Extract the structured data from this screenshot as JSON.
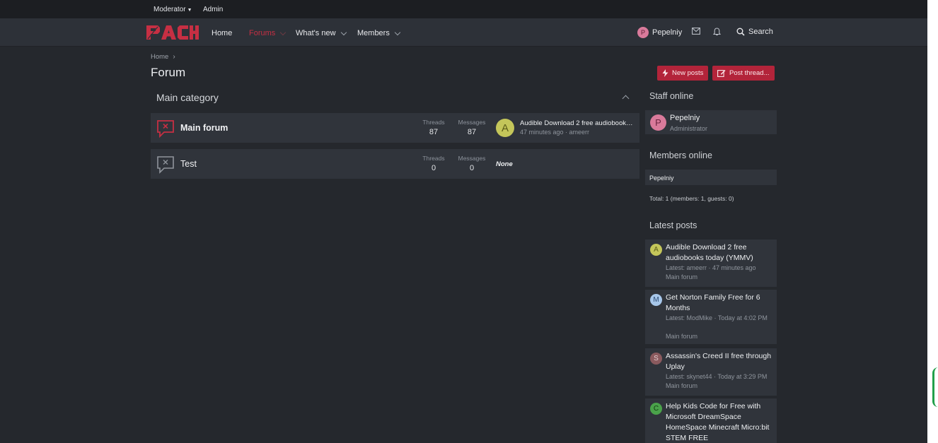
{
  "topbar": {
    "moderator": "Moderator",
    "admin": "Admin"
  },
  "brand": {
    "logo_text": "PACH",
    "accent": "#c62f43"
  },
  "nav": {
    "home": "Home",
    "forums": "Forums",
    "whats_new": "What's new",
    "members": "Members",
    "user": "Pepelniy",
    "user_initial": "P",
    "search": "Search"
  },
  "breadcrumb": {
    "home": "Home"
  },
  "page": {
    "title": "Forum",
    "new_posts": "New posts",
    "post_thread": "Post thread..."
  },
  "category": {
    "title": "Main category",
    "forums": [
      {
        "title": "Main forum",
        "threads_label": "Threads",
        "threads": "87",
        "messages_label": "Messages",
        "messages": "87",
        "latest_initial": "A",
        "latest_title": "Audible Download 2 free audiobooks today (YMMV)",
        "latest_meta": "47 minutes ago · ameerr"
      },
      {
        "title": "Test",
        "threads_label": "Threads",
        "threads": "0",
        "messages_label": "Messages",
        "messages": "0",
        "latest_none": "None"
      }
    ]
  },
  "sidebar": {
    "staff_title": "Staff online",
    "staff": {
      "initial": "P",
      "name": "Pepelniy",
      "role": "Administrator"
    },
    "members_title": "Members online",
    "members": [
      "Pepelniy"
    ],
    "total": "Total: 1 (members: 1, guests: 0)",
    "latest_title": "Latest posts",
    "latest_posts": [
      {
        "initial": "A",
        "color": "#c4c65a",
        "title": "Audible Download 2 free audiobooks today (YMMV)",
        "meta": "Latest: ameerr · 47 minutes ago",
        "forum": "Main forum"
      },
      {
        "initial": "M",
        "color": "#a7c7ea",
        "title": "Get Norton Family Free for 6 Months",
        "meta": "Latest: ModMike · Today at 4:02 PM",
        "forum": "Main forum"
      },
      {
        "initial": "S",
        "color": "#8a5a5e",
        "title": "Assassin's Creed II free through Uplay",
        "meta": "Latest: skynet44 · Today at 3:29 PM",
        "forum": "Main forum"
      },
      {
        "initial": "C",
        "color": "#4aa24a",
        "title": "Help Kids Code for Free with Microsoft DreamSpace HomeSpace Minecraft Micro:bit STEM FREE"
      }
    ]
  }
}
